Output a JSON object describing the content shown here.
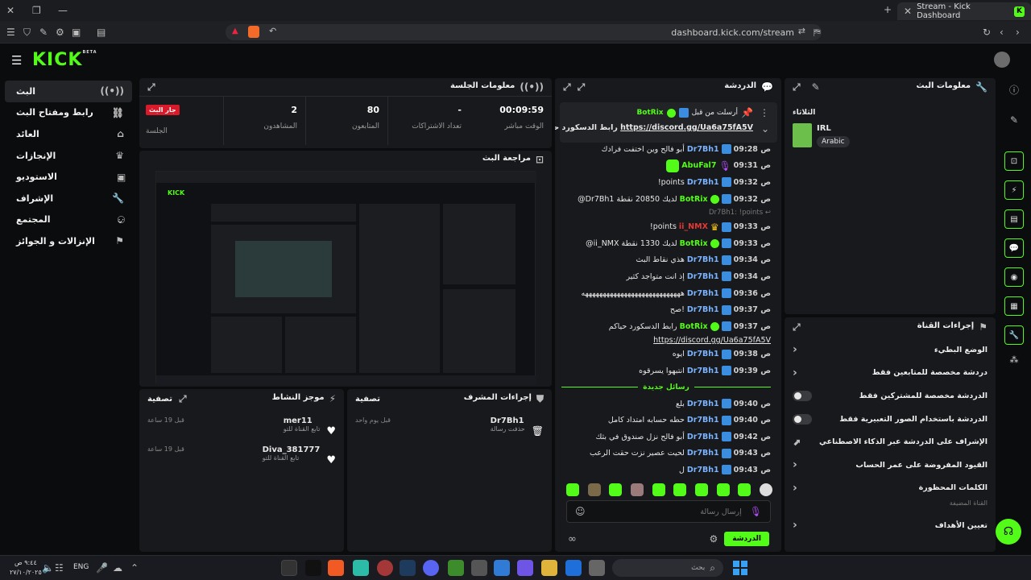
{
  "browser": {
    "tab_title": "Stream - Kick Dashboard",
    "url": "dashboard.kick.com/stream",
    "window_icons": [
      "close-icon",
      "restore-icon",
      "minimize-icon"
    ]
  },
  "app": {
    "logo": "KICK",
    "logo_sup": "BETA"
  },
  "nav": {
    "items": [
      {
        "label": "البث",
        "icon": "broadcast-icon",
        "active": true
      },
      {
        "label": "رابط ومفتاح البث",
        "icon": "link-icon"
      },
      {
        "label": "العائد",
        "icon": "bank-icon"
      },
      {
        "label": "الإنجازات",
        "icon": "trophy-icon"
      },
      {
        "label": "الاستوديو",
        "icon": "studio-icon"
      },
      {
        "label": "الإشراف",
        "icon": "wrench-icon"
      },
      {
        "label": "المجتمع",
        "icon": "community-icon"
      },
      {
        "label": "الإنزالات و الجوائز",
        "icon": "drops-icon"
      }
    ]
  },
  "session": {
    "title": "معلومات الجلسة",
    "live_badge": "جار البث",
    "session_label": "الجلسة",
    "stats": [
      {
        "value": "00:09:59",
        "label": "الوقت مباشر"
      },
      {
        "value": "-",
        "label": "تعداد الاشتراكات"
      },
      {
        "value": "80",
        "label": "المتابعون"
      },
      {
        "value": "2",
        "label": "المشاهدون"
      }
    ]
  },
  "preview": {
    "title": "مراجعة البث"
  },
  "activity": {
    "title": "موجز النشاط",
    "filter": "تصفية",
    "items": [
      {
        "user": "mer11",
        "sub": "تابع القناة للتو",
        "time": "قبل 19 ساعة"
      },
      {
        "user": "Diva_381777",
        "sub": "تابع القناة للتو",
        "time": "قبل 19 ساعة"
      }
    ]
  },
  "modactions": {
    "title": "إجراءات المشرف",
    "filter": "تصفية",
    "items": [
      {
        "user": "Dr7Bh1",
        "sub": "حذفت رسالة",
        "time": "قبل يوم واحد"
      }
    ]
  },
  "chat": {
    "title": "الدردشة",
    "pinned_header": "أرسلت من قبل",
    "pinned_user": "BotRix",
    "pinned_text": "رابط الدسكورد حياكم",
    "pinned_link": "https://discord.gg/Ua6a75fA5V",
    "new_messages": "رسائل جديدة",
    "input_placeholder": "إرسال رسالة",
    "send_button": "الدردشة",
    "messages": [
      {
        "time": "09:28 ص",
        "user": "Dr7Bh1",
        "text": "أبو فالح وين اختفت فرادك",
        "green": false
      },
      {
        "time": "09:31 ص",
        "user": "AbuFal7",
        "text": "",
        "green": true
      },
      {
        "time": "09:32 ص",
        "user": "Dr7Bh1",
        "text": "!points",
        "green": false
      },
      {
        "time": "09:32 ص",
        "user": "BotRix",
        "text": "@Dr7Bh1 لديك 20850 نقطة",
        "green": true
      },
      {
        "time": "09:33 ص",
        "user": "ii_NMX",
        "text": "!points",
        "green": false
      },
      {
        "time": "09:33 ص",
        "user": "BotRix",
        "text": "@ii_NMX لديك 1330 نقطة",
        "green": true
      },
      {
        "time": "09:34 ص",
        "user": "Dr7Bh1",
        "text": "هذي نقاط البث",
        "green": false
      },
      {
        "time": "09:34 ص",
        "user": "Dr7Bh1",
        "text": "إذ انت متواجد كثير",
        "green": false
      },
      {
        "time": "09:36 ص",
        "user": "Dr7Bh1",
        "text": "ههههههههههههههههههههههههههههه",
        "green": false
      },
      {
        "time": "09:37 ص",
        "user": "Dr7Bh1",
        "text": "صح!",
        "green": false
      },
      {
        "time": "09:37 ص",
        "user": "BotRix",
        "text": "رابط الدسكورد حياكم",
        "green": true
      },
      {
        "time": "09:38 ص",
        "user": "Dr7Bh1",
        "text": "ايوه",
        "green": false
      },
      {
        "time": "09:39 ص",
        "user": "Dr7Bh1",
        "text": "انتبهوا يسرقوه",
        "green": false
      }
    ],
    "messages_after": [
      {
        "time": "09:40 ص",
        "user": "Dr7Bh1",
        "text": "بلع",
        "green": false
      },
      {
        "time": "09:40 ص",
        "user": "Dr7Bh1",
        "text": "حطه حسابه امتداد كامل",
        "green": false
      },
      {
        "time": "09:42 ص",
        "user": "Dr7Bh1",
        "text": "أبو فالح نزل صندوق في بثك",
        "green": false
      },
      {
        "time": "09:43 ص",
        "user": "Dr7Bh1",
        "text": "لحيت عصير نزت حقت الرعب",
        "green": false
      },
      {
        "time": "09:43 ص",
        "user": "Dr7Bh1",
        "text": "ل",
        "green": false
      }
    ],
    "link_line": "https://discord.gg/Ua6a75fA5V"
  },
  "streaminfo": {
    "title": "معلومات البث",
    "day": "الثلاثاء",
    "category": "IRL",
    "language": "Arabic"
  },
  "channelactions": {
    "title": "إجراءات القناة",
    "rows": [
      {
        "label": "الوضع البطيء",
        "control": "chevron"
      },
      {
        "label": "دردشة مخصصة للمتابعين فقط",
        "control": "chevron"
      },
      {
        "label": "الدردشة مخصصة للمشتركين فقط",
        "control": "toggle"
      },
      {
        "label": "الدردشة باستخدام الصور التعبيرية فقط",
        "control": "toggle"
      },
      {
        "label": "الإشراف على الدردشة عبر الذكاء الاصطناعي",
        "control": "external"
      },
      {
        "label": "القيود المفروضة على عمر الحساب",
        "control": "chevron"
      },
      {
        "label": "الكلمات المحظورة",
        "control": "chevron"
      }
    ],
    "hidden_label": "القناة المضيفة",
    "last_row": "تعيين الأهداف"
  },
  "taskbar": {
    "lang": "ENG",
    "time": "٩:٤٤ ص",
    "date": "٢٧/١٠/٢٠٢٥",
    "search": "بحث"
  }
}
